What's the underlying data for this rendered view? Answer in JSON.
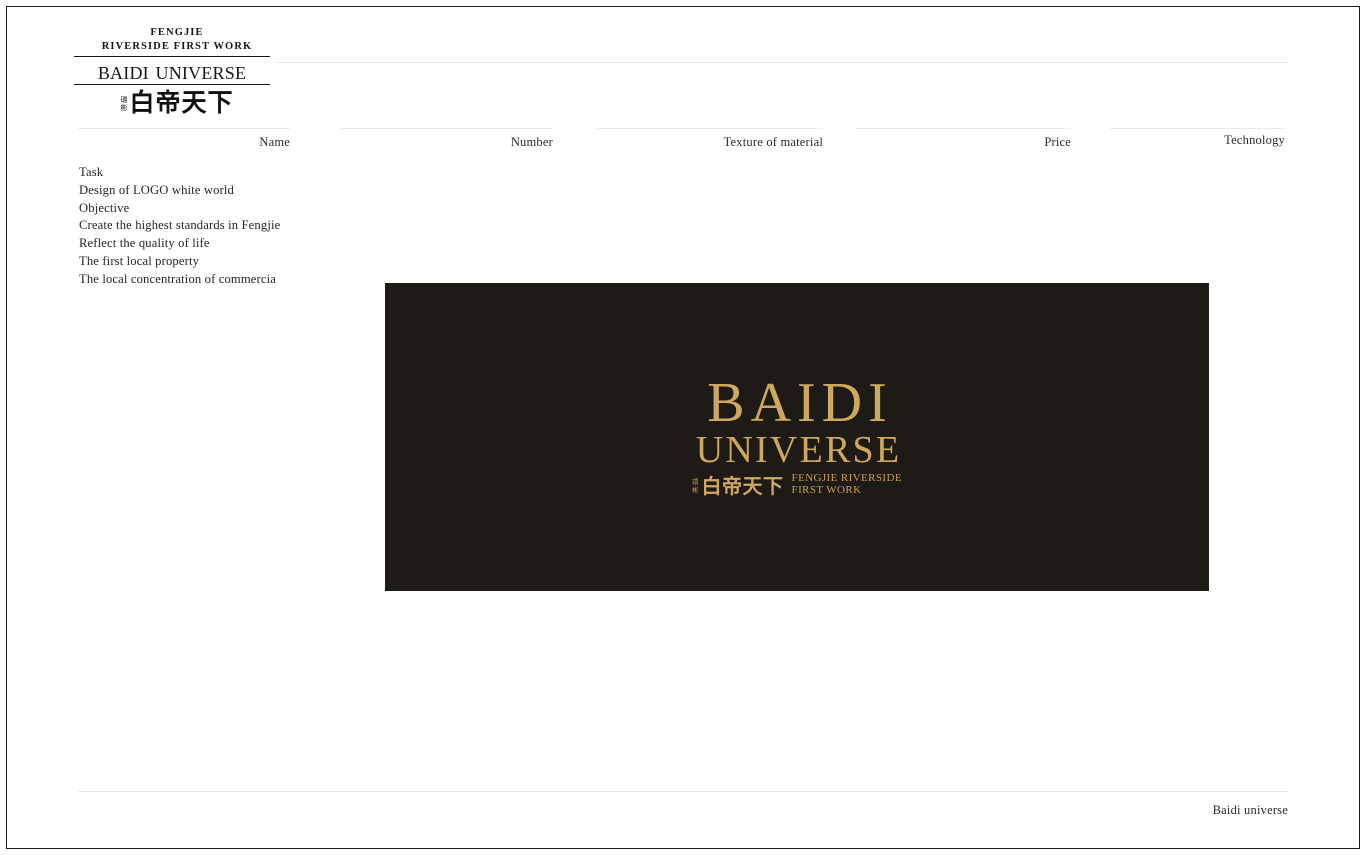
{
  "brand": {
    "tagline_line1": "FENGJIE",
    "tagline_line2": "RIVERSIDE FIRST WORK",
    "name_en": "BAIDI UNIVERSE",
    "name_cn_small_top": "環",
    "name_cn_small_bottom": "彬",
    "name_cn": "白帝天下"
  },
  "columns": [
    {
      "label": "Name"
    },
    {
      "label": "Number"
    },
    {
      "label": "Texture of material"
    },
    {
      "label": "Price"
    },
    {
      "label": "Technology"
    }
  ],
  "brief": {
    "items": [
      "Task",
      "Design of LOGO white world",
      "Objective",
      "Create the highest standards in Fengjie",
      "Reflect the quality of life",
      "The first local property",
      "The local concentration of commercia"
    ]
  },
  "logo_panel": {
    "title_line1": "BAIDI",
    "title_line2": "UNIVERSE",
    "cn_small_top": "環",
    "cn_small_bottom": "彬",
    "cn_main": "白帝天下",
    "en_line1": "FENGJIE  RIVERSIDE",
    "en_line2": "FIRST WORK",
    "background_color": "#1E1A15",
    "gold_color": "#CFA85F"
  },
  "footer": {
    "label": "Baidi universe"
  }
}
